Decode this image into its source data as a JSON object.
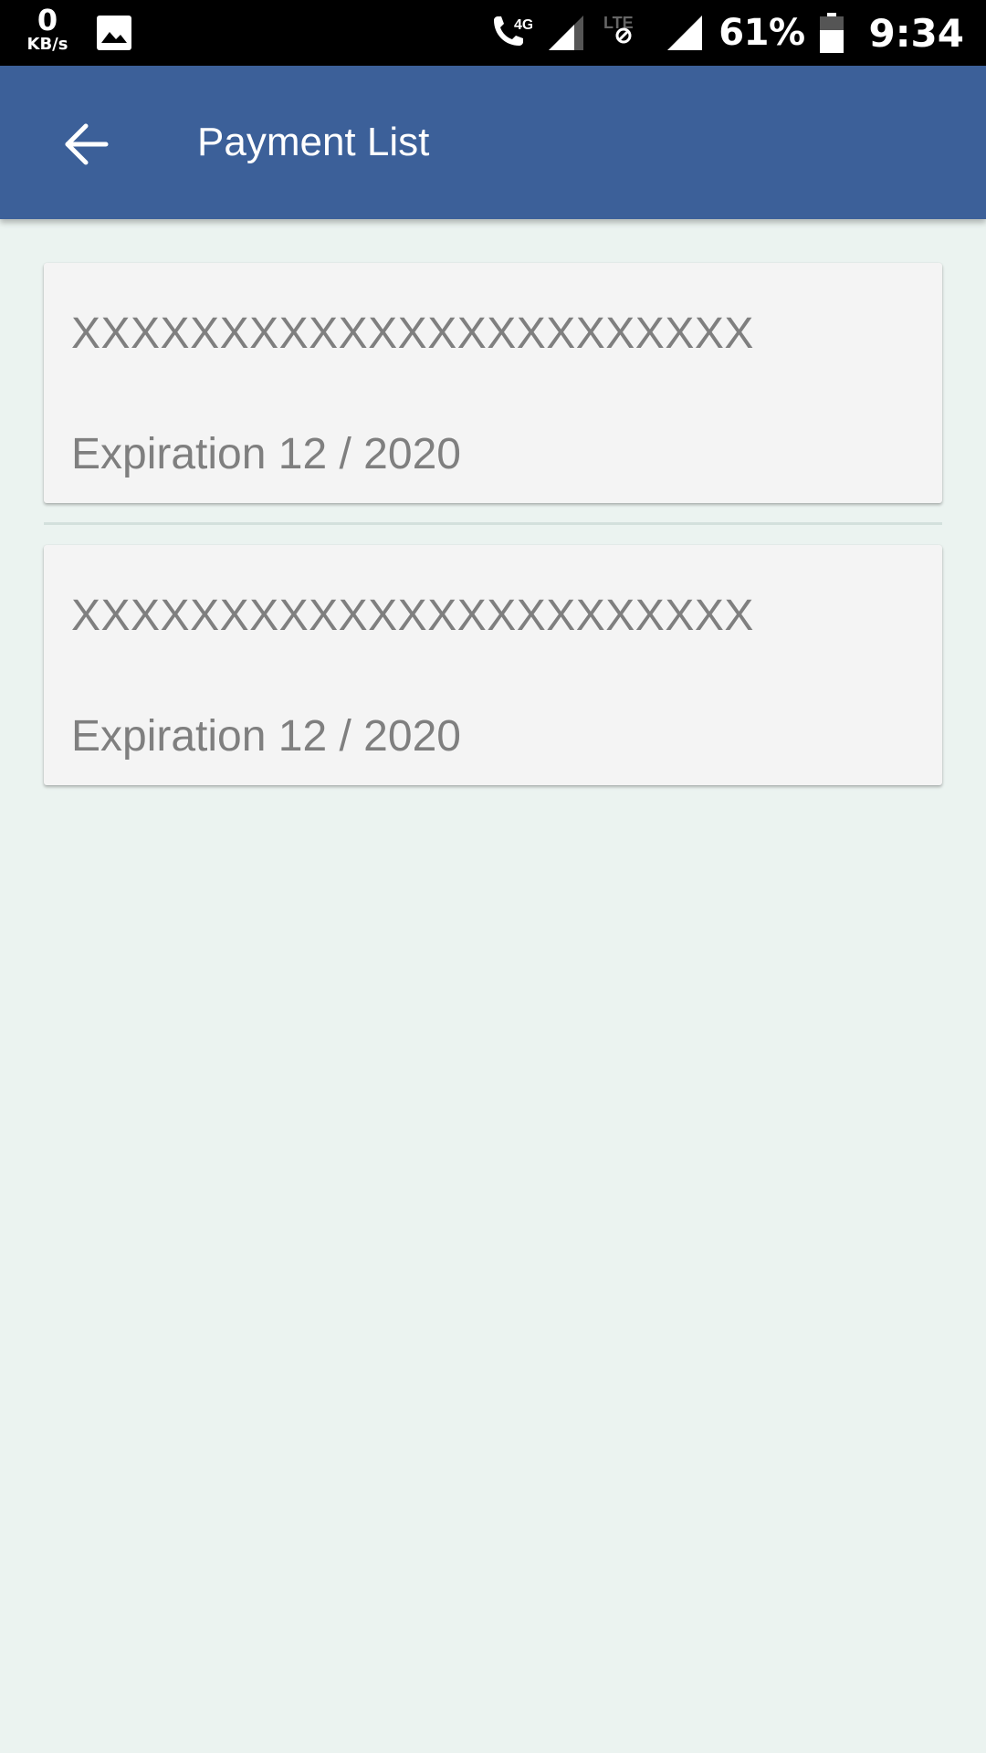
{
  "status_bar": {
    "speed_value": "0",
    "speed_unit": "KB/s",
    "network_label": "4G",
    "lte_label": "LTE",
    "battery_percent": "61%",
    "time": "9:34"
  },
  "app_bar": {
    "title": "Payment List",
    "back_icon": "arrow-back-icon",
    "background_color": "#3c6099"
  },
  "payments": [
    {
      "card_number": "XXXXXXXXXXXXXXXXXXXXXXX",
      "expiration": "Expiration 12 / 2020"
    },
    {
      "card_number": "XXXXXXXXXXXXXXXXXXXXXXX",
      "expiration": "Expiration 12 / 2020"
    }
  ]
}
